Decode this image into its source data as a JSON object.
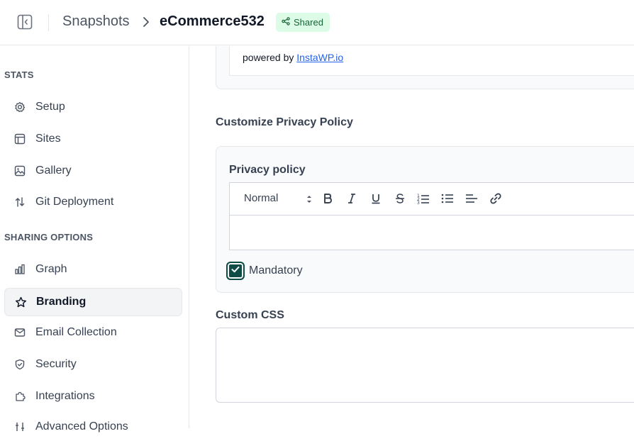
{
  "header": {
    "breadcrumb_root": "Snapshots",
    "breadcrumb_current": "eCommerce532",
    "badge": "Shared"
  },
  "sidebar": {
    "sections": [
      {
        "title": "STATS"
      },
      {
        "title": "SHARING OPTIONS"
      }
    ],
    "items": [
      {
        "label": "Setup",
        "icon": "gear-icon"
      },
      {
        "label": "Sites",
        "icon": "layout-icon"
      },
      {
        "label": "Gallery",
        "icon": "image-icon"
      },
      {
        "label": "Git Deployment",
        "icon": "arrows-up-down-icon"
      },
      {
        "label": "Graph",
        "icon": "bar-chart-icon"
      },
      {
        "label": "Branding",
        "icon": "star-icon",
        "active": true
      },
      {
        "label": "Email Collection",
        "icon": "mail-icon"
      },
      {
        "label": "Security",
        "icon": "shield-icon"
      },
      {
        "label": "Integrations",
        "icon": "puzzle-icon"
      },
      {
        "label": "Advanced Options",
        "icon": "sliders-icon"
      }
    ]
  },
  "main": {
    "powered_prefix": "powered by",
    "powered_link": "InstaWP.io",
    "privacy_section_title": "Customize Privacy Policy",
    "privacy_label": "Privacy policy",
    "editor_format": "Normal",
    "mandatory_label": "Mandatory",
    "mandatory_checked": true,
    "custom_css_label": "Custom CSS"
  },
  "colors": {
    "accent": "#0f4c46",
    "badge_bg": "#dcfce7",
    "badge_text": "#166534",
    "link": "#2563eb"
  }
}
